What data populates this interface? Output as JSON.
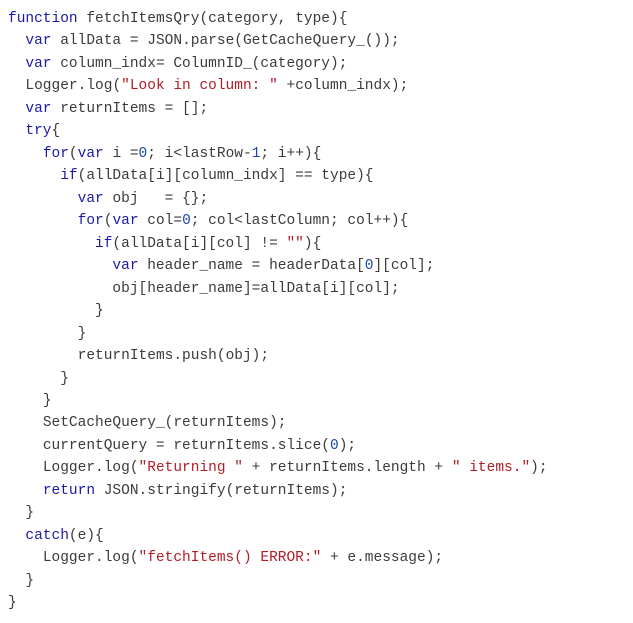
{
  "code": {
    "lines": [
      {
        "indent": 0,
        "tokens": [
          {
            "t": "kw",
            "v": "function"
          },
          {
            "t": "p",
            "v": " "
          },
          {
            "t": "fn",
            "v": "fetchItemsQry"
          },
          {
            "t": "p",
            "v": "("
          },
          {
            "t": "fn",
            "v": "category"
          },
          {
            "t": "p",
            "v": ", "
          },
          {
            "t": "fn",
            "v": "type"
          },
          {
            "t": "p",
            "v": "){"
          }
        ]
      },
      {
        "indent": 1,
        "tokens": [
          {
            "t": "kw",
            "v": "var"
          },
          {
            "t": "p",
            "v": " "
          },
          {
            "t": "fn",
            "v": "allData"
          },
          {
            "t": "p",
            "v": " = "
          },
          {
            "t": "fn",
            "v": "JSON"
          },
          {
            "t": "p",
            "v": "."
          },
          {
            "t": "fn",
            "v": "parse"
          },
          {
            "t": "p",
            "v": "("
          },
          {
            "t": "fn",
            "v": "GetCacheQuery_"
          },
          {
            "t": "p",
            "v": "());"
          }
        ]
      },
      {
        "indent": 1,
        "tokens": [
          {
            "t": "kw",
            "v": "var"
          },
          {
            "t": "p",
            "v": " "
          },
          {
            "t": "fn",
            "v": "column_indx"
          },
          {
            "t": "p",
            "v": "= "
          },
          {
            "t": "fn",
            "v": "ColumnID_"
          },
          {
            "t": "p",
            "v": "("
          },
          {
            "t": "fn",
            "v": "category"
          },
          {
            "t": "p",
            "v": ");"
          }
        ]
      },
      {
        "indent": 1,
        "tokens": [
          {
            "t": "fn",
            "v": "Logger"
          },
          {
            "t": "p",
            "v": "."
          },
          {
            "t": "fn",
            "v": "log"
          },
          {
            "t": "p",
            "v": "("
          },
          {
            "t": "str",
            "v": "\"Look in column: \""
          },
          {
            "t": "p",
            "v": " +"
          },
          {
            "t": "fn",
            "v": "column_indx"
          },
          {
            "t": "p",
            "v": ");"
          }
        ]
      },
      {
        "indent": 1,
        "tokens": [
          {
            "t": "kw",
            "v": "var"
          },
          {
            "t": "p",
            "v": " "
          },
          {
            "t": "fn",
            "v": "returnItems"
          },
          {
            "t": "p",
            "v": " = [];"
          }
        ]
      },
      {
        "indent": 1,
        "tokens": [
          {
            "t": "kw",
            "v": "try"
          },
          {
            "t": "p",
            "v": "{"
          }
        ]
      },
      {
        "indent": 2,
        "tokens": [
          {
            "t": "kw",
            "v": "for"
          },
          {
            "t": "p",
            "v": "("
          },
          {
            "t": "kw",
            "v": "var"
          },
          {
            "t": "p",
            "v": " "
          },
          {
            "t": "fn",
            "v": "i"
          },
          {
            "t": "p",
            "v": " ="
          },
          {
            "t": "num",
            "v": "0"
          },
          {
            "t": "p",
            "v": "; "
          },
          {
            "t": "fn",
            "v": "i"
          },
          {
            "t": "p",
            "v": "<"
          },
          {
            "t": "fn",
            "v": "lastRow"
          },
          {
            "t": "p",
            "v": "-"
          },
          {
            "t": "num",
            "v": "1"
          },
          {
            "t": "p",
            "v": "; "
          },
          {
            "t": "fn",
            "v": "i"
          },
          {
            "t": "p",
            "v": "++){"
          }
        ]
      },
      {
        "indent": 3,
        "tokens": [
          {
            "t": "kw",
            "v": "if"
          },
          {
            "t": "p",
            "v": "("
          },
          {
            "t": "fn",
            "v": "allData"
          },
          {
            "t": "p",
            "v": "["
          },
          {
            "t": "fn",
            "v": "i"
          },
          {
            "t": "p",
            "v": "]["
          },
          {
            "t": "fn",
            "v": "column_indx"
          },
          {
            "t": "p",
            "v": "] == "
          },
          {
            "t": "fn",
            "v": "type"
          },
          {
            "t": "p",
            "v": "){"
          }
        ]
      },
      {
        "indent": 4,
        "tokens": [
          {
            "t": "kw",
            "v": "var"
          },
          {
            "t": "p",
            "v": " "
          },
          {
            "t": "fn",
            "v": "obj"
          },
          {
            "t": "p",
            "v": "   = {};"
          }
        ]
      },
      {
        "indent": 4,
        "tokens": [
          {
            "t": "kw",
            "v": "for"
          },
          {
            "t": "p",
            "v": "("
          },
          {
            "t": "kw",
            "v": "var"
          },
          {
            "t": "p",
            "v": " "
          },
          {
            "t": "fn",
            "v": "col"
          },
          {
            "t": "p",
            "v": "="
          },
          {
            "t": "num",
            "v": "0"
          },
          {
            "t": "p",
            "v": "; "
          },
          {
            "t": "fn",
            "v": "col"
          },
          {
            "t": "p",
            "v": "<"
          },
          {
            "t": "fn",
            "v": "lastColumn"
          },
          {
            "t": "p",
            "v": "; "
          },
          {
            "t": "fn",
            "v": "col"
          },
          {
            "t": "p",
            "v": "++){"
          }
        ]
      },
      {
        "indent": 5,
        "tokens": [
          {
            "t": "kw",
            "v": "if"
          },
          {
            "t": "p",
            "v": "("
          },
          {
            "t": "fn",
            "v": "allData"
          },
          {
            "t": "p",
            "v": "["
          },
          {
            "t": "fn",
            "v": "i"
          },
          {
            "t": "p",
            "v": "]["
          },
          {
            "t": "fn",
            "v": "col"
          },
          {
            "t": "p",
            "v": "] != "
          },
          {
            "t": "str",
            "v": "\"\""
          },
          {
            "t": "p",
            "v": "){"
          }
        ]
      },
      {
        "indent": 6,
        "tokens": [
          {
            "t": "kw",
            "v": "var"
          },
          {
            "t": "p",
            "v": " "
          },
          {
            "t": "fn",
            "v": "header_name"
          },
          {
            "t": "p",
            "v": " = "
          },
          {
            "t": "fn",
            "v": "headerData"
          },
          {
            "t": "p",
            "v": "["
          },
          {
            "t": "num",
            "v": "0"
          },
          {
            "t": "p",
            "v": "]["
          },
          {
            "t": "fn",
            "v": "col"
          },
          {
            "t": "p",
            "v": "];"
          }
        ]
      },
      {
        "indent": 6,
        "tokens": [
          {
            "t": "fn",
            "v": "obj"
          },
          {
            "t": "p",
            "v": "["
          },
          {
            "t": "fn",
            "v": "header_name"
          },
          {
            "t": "p",
            "v": "]="
          },
          {
            "t": "fn",
            "v": "allData"
          },
          {
            "t": "p",
            "v": "["
          },
          {
            "t": "fn",
            "v": "i"
          },
          {
            "t": "p",
            "v": "]["
          },
          {
            "t": "fn",
            "v": "col"
          },
          {
            "t": "p",
            "v": "];"
          }
        ]
      },
      {
        "indent": 5,
        "tokens": [
          {
            "t": "p",
            "v": "}"
          }
        ]
      },
      {
        "indent": 4,
        "tokens": [
          {
            "t": "p",
            "v": "}"
          }
        ]
      },
      {
        "indent": 4,
        "tokens": [
          {
            "t": "fn",
            "v": "returnItems"
          },
          {
            "t": "p",
            "v": "."
          },
          {
            "t": "fn",
            "v": "push"
          },
          {
            "t": "p",
            "v": "("
          },
          {
            "t": "fn",
            "v": "obj"
          },
          {
            "t": "p",
            "v": ");"
          }
        ]
      },
      {
        "indent": 3,
        "tokens": [
          {
            "t": "p",
            "v": "}"
          }
        ]
      },
      {
        "indent": 2,
        "tokens": [
          {
            "t": "p",
            "v": "}"
          }
        ]
      },
      {
        "indent": 2,
        "tokens": [
          {
            "t": "fn",
            "v": "SetCacheQuery_"
          },
          {
            "t": "p",
            "v": "("
          },
          {
            "t": "fn",
            "v": "returnItems"
          },
          {
            "t": "p",
            "v": ");"
          }
        ]
      },
      {
        "indent": 2,
        "tokens": [
          {
            "t": "fn",
            "v": "currentQuery"
          },
          {
            "t": "p",
            "v": " = "
          },
          {
            "t": "fn",
            "v": "returnItems"
          },
          {
            "t": "p",
            "v": "."
          },
          {
            "t": "fn",
            "v": "slice"
          },
          {
            "t": "p",
            "v": "("
          },
          {
            "t": "num",
            "v": "0"
          },
          {
            "t": "p",
            "v": ");"
          }
        ]
      },
      {
        "indent": 2,
        "tokens": [
          {
            "t": "fn",
            "v": "Logger"
          },
          {
            "t": "p",
            "v": "."
          },
          {
            "t": "fn",
            "v": "log"
          },
          {
            "t": "p",
            "v": "("
          },
          {
            "t": "str",
            "v": "\"Returning \""
          },
          {
            "t": "p",
            "v": " + "
          },
          {
            "t": "fn",
            "v": "returnItems"
          },
          {
            "t": "p",
            "v": "."
          },
          {
            "t": "fn",
            "v": "length"
          },
          {
            "t": "p",
            "v": " + "
          },
          {
            "t": "str",
            "v": "\" items.\""
          },
          {
            "t": "p",
            "v": ");"
          }
        ]
      },
      {
        "indent": 2,
        "tokens": [
          {
            "t": "kw",
            "v": "return"
          },
          {
            "t": "p",
            "v": " "
          },
          {
            "t": "fn",
            "v": "JSON"
          },
          {
            "t": "p",
            "v": "."
          },
          {
            "t": "fn",
            "v": "stringify"
          },
          {
            "t": "p",
            "v": "("
          },
          {
            "t": "fn",
            "v": "returnItems"
          },
          {
            "t": "p",
            "v": ");"
          }
        ]
      },
      {
        "indent": 1,
        "tokens": [
          {
            "t": "p",
            "v": "}"
          }
        ]
      },
      {
        "indent": 1,
        "tokens": [
          {
            "t": "kw",
            "v": "catch"
          },
          {
            "t": "p",
            "v": "("
          },
          {
            "t": "fn",
            "v": "e"
          },
          {
            "t": "p",
            "v": "){"
          }
        ]
      },
      {
        "indent": 2,
        "tokens": [
          {
            "t": "fn",
            "v": "Logger"
          },
          {
            "t": "p",
            "v": "."
          },
          {
            "t": "fn",
            "v": "log"
          },
          {
            "t": "p",
            "v": "("
          },
          {
            "t": "str",
            "v": "\"fetchItems() ERROR:\""
          },
          {
            "t": "p",
            "v": " + "
          },
          {
            "t": "fn",
            "v": "e"
          },
          {
            "t": "p",
            "v": "."
          },
          {
            "t": "fn",
            "v": "message"
          },
          {
            "t": "p",
            "v": ");"
          }
        ]
      },
      {
        "indent": 1,
        "tokens": [
          {
            "t": "p",
            "v": "}"
          }
        ]
      },
      {
        "indent": 0,
        "tokens": [
          {
            "t": "p",
            "v": "}"
          }
        ]
      }
    ],
    "indent_unit": "  "
  }
}
